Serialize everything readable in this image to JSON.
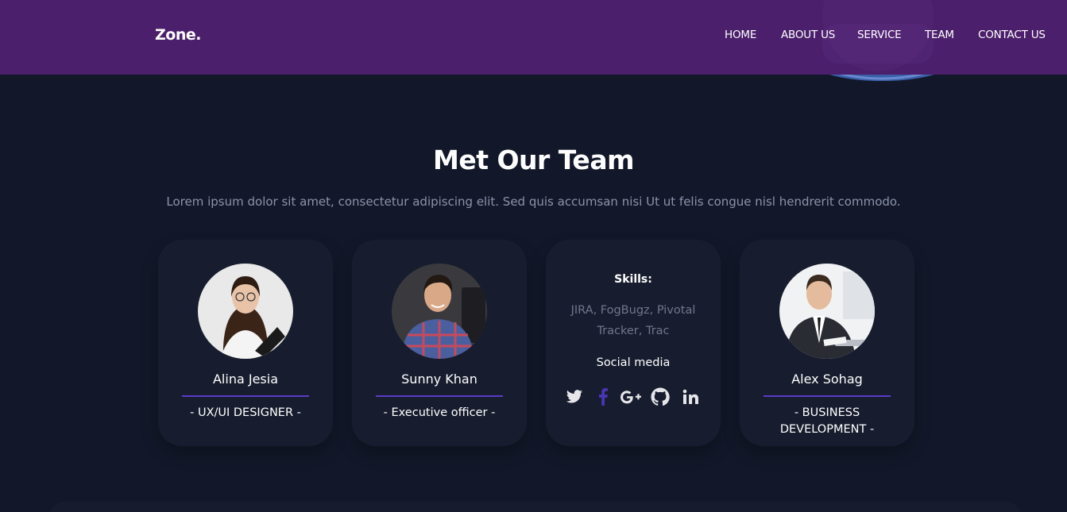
{
  "brand": {
    "logo": "Zone."
  },
  "nav": {
    "items": [
      {
        "label": "HOME"
      },
      {
        "label": "ABOUT US"
      },
      {
        "label": "SERVICE"
      },
      {
        "label": "TEAM"
      },
      {
        "label": "CONTACT US"
      }
    ]
  },
  "section": {
    "title": "Met Our Team",
    "subtitle": "Lorem ipsum dolor sit amet, consectetur adipiscing elit. Sed quis accumsan nisi Ut ut felis congue nisl hendrerit commodo."
  },
  "team": [
    {
      "name": "Alina Jesia",
      "role": "- UX/UI DESIGNER -"
    },
    {
      "name": "Sunny Khan",
      "role": "- Executive officer -"
    },
    {
      "name": "Alex Sohag",
      "role": "- BUSINESS DEVELOPMENT -"
    }
  ],
  "skills_card": {
    "skills_label": "Skills:",
    "skills_text": "JIRA, FogBugz, Pivotal Tracker, Trac",
    "social_label": "Social media",
    "icons": [
      "twitter-icon",
      "facebook-icon",
      "google-plus-icon",
      "github-icon",
      "linkedin-icon"
    ]
  },
  "colors": {
    "header_bg": "#4b1f6b",
    "page_bg": "#121829",
    "card_bg": "#171d2e",
    "accent": "#5a3dc8",
    "muted_text": "#8b93ab"
  }
}
